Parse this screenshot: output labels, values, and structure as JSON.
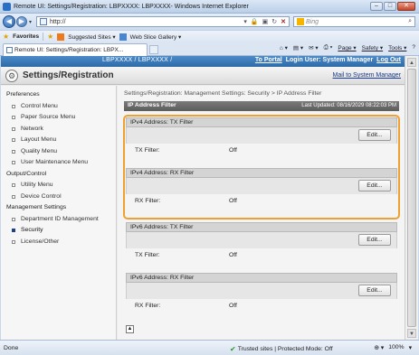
{
  "window": {
    "title": "Remote UI: Settings/Registration: LBPXXXX: LBPXXXX- Windows Internet Explorer",
    "min_glyph": "–",
    "max_glyph": "□",
    "close_glyph": "✕"
  },
  "browser": {
    "back_glyph": "◀",
    "forward_glyph": "▶",
    "dropdown_glyph": "▾",
    "address": "http://",
    "search_placeholder": "Bing",
    "search_glyph": "⌕",
    "favorites_label": "Favorites",
    "suggested_sites": "Suggested Sites ▾",
    "web_slice": "Web Slice Gallery ▾",
    "tab_label": "Remote UI: Settings/Registration: LBPX...",
    "commands": [
      "Page ▾",
      "Safety ▾",
      "Tools ▾"
    ],
    "command_icons": [
      "⌂ ▾",
      "▤ ▾",
      "✉ ▾",
      "⎙ ▾"
    ],
    "help_glyph": "?"
  },
  "device": {
    "model": "LBPXXXX / LBPXXXX /",
    "to_portal": "To Portal",
    "login_user": "Login User: System Manager",
    "logout": "Log Out"
  },
  "header": {
    "title": "Settings/Registration",
    "mail_link": "Mail to System Manager"
  },
  "sidebar": {
    "groups": [
      {
        "heading": "Preferences",
        "items": [
          "Control Menu",
          "Paper Source Menu",
          "Network",
          "Layout Menu",
          "Quality Menu",
          "User Maintenance Menu"
        ]
      },
      {
        "heading": "Output/Control",
        "items": [
          "Utility Menu",
          "Device Control"
        ]
      },
      {
        "heading": "Management Settings",
        "items": [
          "Department ID Management",
          "Security",
          "License/Other"
        ]
      }
    ],
    "active": "Security"
  },
  "main": {
    "breadcrumb": "Settings/Registration: Management Settings: Security > IP Address Filter",
    "panel_title": "IP Address Filter",
    "last_updated": "Last Updated: 08/16/2029 08:22:03 PM",
    "edit_label": "Edit...",
    "sections": [
      {
        "title": "IPv4 Address: TX Filter",
        "label": "TX Filter:",
        "value": "Off"
      },
      {
        "title": "IPv4 Address: RX Filter",
        "label": "RX Filter:",
        "value": "Off"
      },
      {
        "title": "IPv6 Address: TX Filter",
        "label": "TX Filter:",
        "value": "Off"
      },
      {
        "title": "IPv6 Address: RX Filter",
        "label": "RX Filter:",
        "value": "Off"
      }
    ],
    "top_glyph": "▲"
  },
  "status": {
    "done": "Done",
    "zone": "Trusted sites | Protected Mode: Off",
    "zoom": "100%",
    "zoom_controls": "⊕ ▾"
  },
  "colors": {
    "highlight": "#f0a030",
    "brand_bar": "#2e6aa8"
  }
}
